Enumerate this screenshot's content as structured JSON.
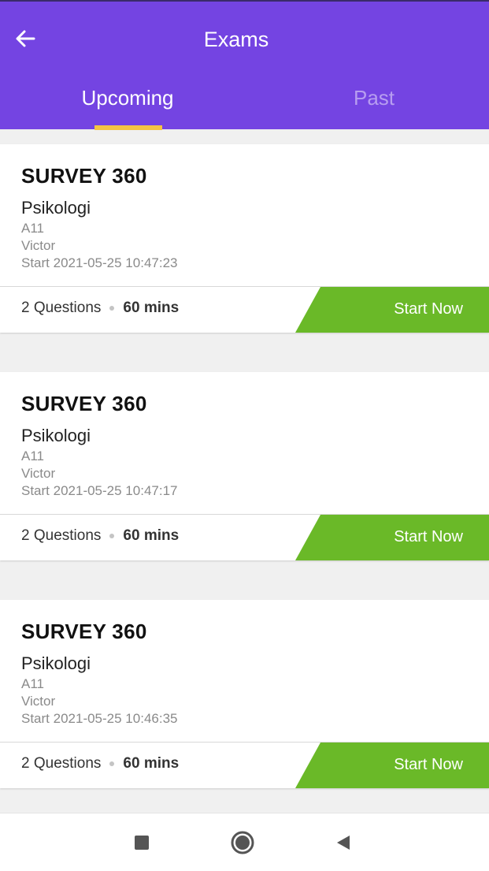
{
  "header": {
    "title": "Exams",
    "back_icon": "arrow-left-icon",
    "background": "#7444e2",
    "tabs": [
      {
        "label": "Upcoming",
        "active": true
      },
      {
        "label": "Past",
        "active": false
      }
    ],
    "indicator_color": "#f5c542"
  },
  "exams": [
    {
      "title": "SURVEY 360",
      "subject": "Psikologi",
      "code": "A11",
      "owner": "Victor",
      "start": "Start 2021-05-25 10:47:23",
      "questions": "2 Questions",
      "duration": "60 mins",
      "action_label": "Start Now"
    },
    {
      "title": "SURVEY 360",
      "subject": "Psikologi",
      "code": "A11",
      "owner": "Victor",
      "start": "Start 2021-05-25 10:47:17",
      "questions": "2 Questions",
      "duration": "60 mins",
      "action_label": "Start Now"
    },
    {
      "title": "SURVEY 360",
      "subject": "Psikologi",
      "code": "A11",
      "owner": "Victor",
      "start": "Start 2021-05-25 10:46:35",
      "questions": "2 Questions",
      "duration": "60 mins",
      "action_label": "Start Now"
    }
  ],
  "action_color": "#6ab928",
  "system_nav": {
    "icons": [
      "square-recents-icon",
      "circle-home-icon",
      "triangle-back-icon"
    ]
  }
}
